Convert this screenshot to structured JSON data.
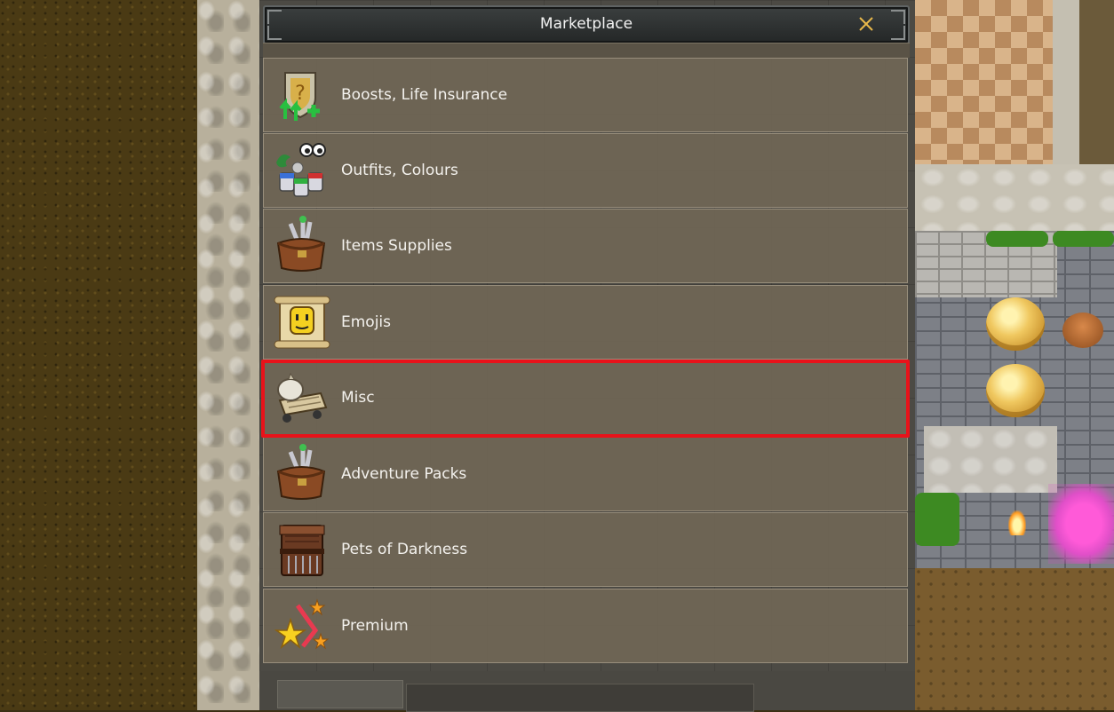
{
  "window": {
    "title": "Marketplace"
  },
  "categories": [
    {
      "label": "Boosts, Life Insurance",
      "icon": "shield-boost-icon"
    },
    {
      "label": "Outfits, Colours",
      "icon": "paint-buckets-icon"
    },
    {
      "label": "Items Supplies",
      "icon": "satchel-icon"
    },
    {
      "label": "Emojis",
      "icon": "emoji-scroll-icon"
    },
    {
      "label": "Misc",
      "icon": "cart-sack-icon"
    },
    {
      "label": "Adventure Packs",
      "icon": "adventure-bag-icon"
    },
    {
      "label": "Pets of Darkness",
      "icon": "crate-icon"
    },
    {
      "label": "Premium",
      "icon": "stars-icon"
    }
  ],
  "selected_category": "Misc",
  "colors": {
    "highlight": "#e8121a",
    "row_background": "#706656",
    "title_text": "#f2f2f2"
  }
}
